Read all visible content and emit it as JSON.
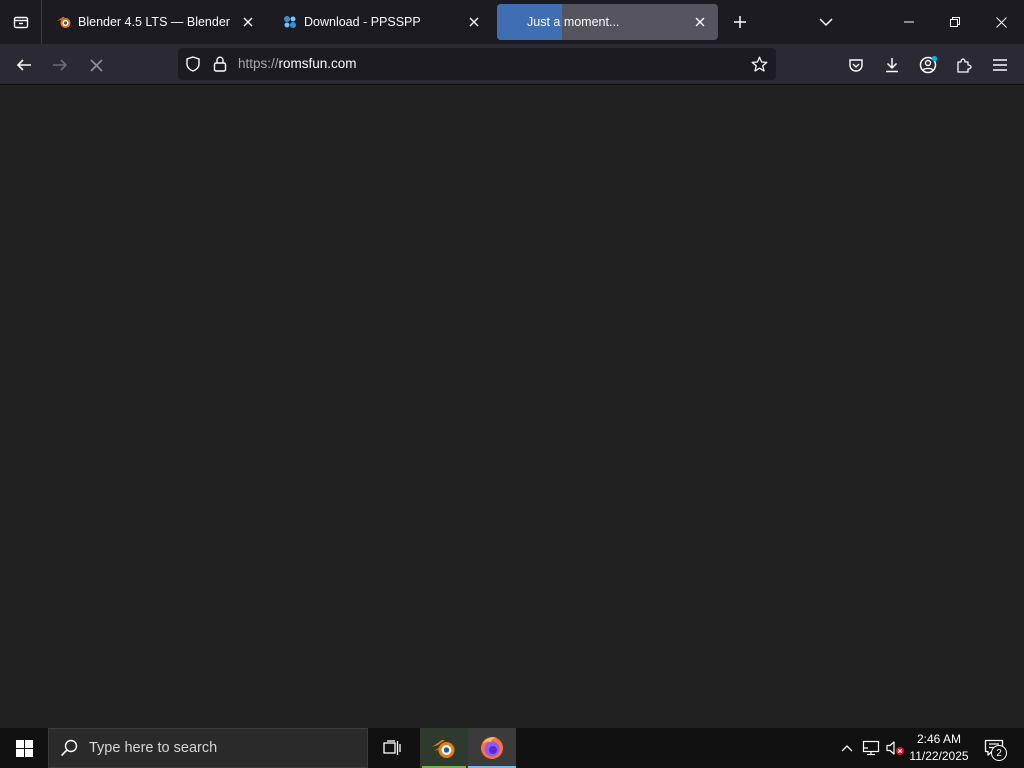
{
  "browser": {
    "tabs": [
      {
        "title": "Blender 4.5 LTS — Blender",
        "favicon": "blender-icon",
        "active": false
      },
      {
        "title": "Download - PPSSPP",
        "favicon": "ppsspp-icon",
        "active": false
      },
      {
        "title": "Just a moment...",
        "favicon": "loading",
        "active": true,
        "loading": true
      }
    ],
    "url": {
      "scheme": "https://",
      "host": "romsfun.com"
    },
    "icons": {
      "tab_list": "tab-list-icon",
      "new_tab": "plus-icon",
      "all_tabs": "chevron-down-icon",
      "back": "back-arrow-icon",
      "forward": "forward-arrow-icon",
      "stop": "stop-icon",
      "tracking_protection": "shield-icon",
      "lock": "lock-icon",
      "bookmark": "star-icon",
      "pocket": "pocket-icon",
      "downloads": "download-icon",
      "account": "account-icon",
      "extensions": "puzzle-icon",
      "menu": "hamburger-icon"
    },
    "colors": {
      "accent_progress": "#3f6fb2",
      "content_background": "#212121"
    }
  },
  "taskbar": {
    "search_placeholder": "Type here to search",
    "apps": [
      {
        "name": "Blender",
        "icon": "blender-icon",
        "running": true
      },
      {
        "name": "Firefox",
        "icon": "firefox-icon",
        "running": true,
        "active": true
      }
    ],
    "clock": {
      "time": "2:46 AM",
      "date": "11/22/2025"
    },
    "notification_count": "2"
  }
}
